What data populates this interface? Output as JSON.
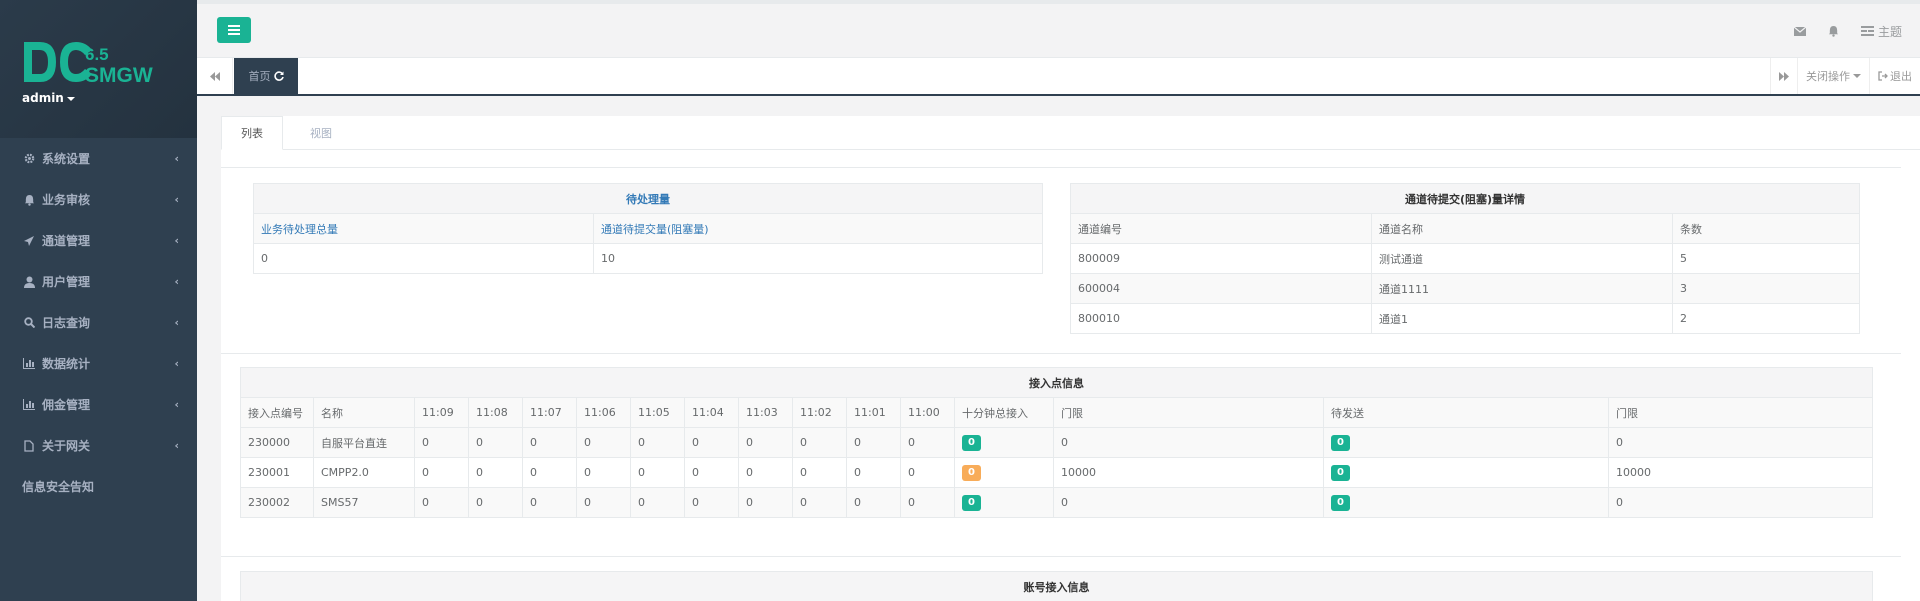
{
  "brand": {
    "version": "6.5",
    "name": "SMGW",
    "user": "admin"
  },
  "sidebar": {
    "items": [
      {
        "label": "系统设置",
        "icon": "gear-icon"
      },
      {
        "label": "业务审核",
        "icon": "bell-icon"
      },
      {
        "label": "通道管理",
        "icon": "paper-plane-icon"
      },
      {
        "label": "用户管理",
        "icon": "user-icon"
      },
      {
        "label": "日志查询",
        "icon": "search-icon"
      },
      {
        "label": "数据统计",
        "icon": "bar-chart-icon"
      },
      {
        "label": "佣金管理",
        "icon": "bar-chart-icon"
      },
      {
        "label": "关于网关",
        "icon": "file-icon"
      }
    ],
    "plain_item": "信息安全告知"
  },
  "topbar": {
    "theme_label": "主题"
  },
  "tabbar": {
    "home_tab": "首页",
    "close_ops": "关闭操作",
    "logout": "退出"
  },
  "tabs": {
    "list": "列表",
    "view": "视图"
  },
  "pending": {
    "title": "待处理量",
    "headers": [
      "业务待处理总量",
      "通道待提交量(阻塞量)"
    ],
    "values": [
      "0",
      "10"
    ]
  },
  "channel_detail": {
    "title": "通道待提交(阻塞)量详情",
    "headers": [
      "通道编号",
      "通道名称",
      "条数"
    ],
    "rows": [
      [
        "800009",
        "测试通道",
        "5"
      ],
      [
        "600004",
        "通道1111",
        "3"
      ],
      [
        "800010",
        "通道1",
        "2"
      ]
    ]
  },
  "access_points": {
    "title": "接入点信息",
    "headers": [
      "接入点编号",
      "名称",
      "11:09",
      "11:08",
      "11:07",
      "11:06",
      "11:05",
      "11:04",
      "11:03",
      "11:02",
      "11:01",
      "11:00",
      "十分钟总接入",
      "门限",
      "待发送",
      "门限"
    ],
    "rows": [
      {
        "id": "230000",
        "name": "自服平台直连",
        "mins": [
          "0",
          "0",
          "0",
          "0",
          "0",
          "0",
          "0",
          "0",
          "0",
          "0"
        ],
        "total": "0",
        "total_color": "#1ab394",
        "limit1": "0",
        "pending": "0",
        "limit2": "0"
      },
      {
        "id": "230001",
        "name": "CMPP2.0",
        "mins": [
          "0",
          "0",
          "0",
          "0",
          "0",
          "0",
          "0",
          "0",
          "0",
          "0"
        ],
        "total": "0",
        "total_color": "#f8ac59",
        "limit1": "10000",
        "pending": "0",
        "limit2": "10000"
      },
      {
        "id": "230002",
        "name": "SMS57",
        "mins": [
          "0",
          "0",
          "0",
          "0",
          "0",
          "0",
          "0",
          "0",
          "0",
          "0"
        ],
        "total": "0",
        "total_color": "#1ab394",
        "limit1": "0",
        "pending": "0",
        "limit2": "0"
      }
    ]
  },
  "account_access": {
    "title": "账号接入信息"
  },
  "colors": {
    "sidebar": "#2f4050",
    "accent": "#1ab394",
    "warning": "#f8ac59"
  }
}
